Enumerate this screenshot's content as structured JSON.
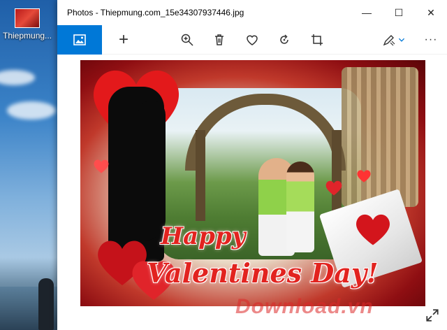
{
  "desktop": {
    "icon_label": "Thiepmung..."
  },
  "window": {
    "title": "Photos - Thiepmung.com_15e34307937446.jpg",
    "controls": {
      "minimize": "—",
      "maximize": "☐",
      "close": "✕"
    }
  },
  "toolbar": {
    "items": [
      {
        "name": "see-all-photos",
        "icon": "image-icon"
      },
      {
        "name": "add",
        "icon": "plus-icon",
        "glyph": "+"
      },
      {
        "name": "zoom",
        "icon": "zoom-in-icon"
      },
      {
        "name": "delete",
        "icon": "trash-icon"
      },
      {
        "name": "favorite",
        "icon": "heart-icon"
      },
      {
        "name": "rotate",
        "icon": "rotate-icon"
      },
      {
        "name": "crop",
        "icon": "crop-icon"
      },
      {
        "name": "edit",
        "icon": "edit-create-icon"
      },
      {
        "name": "more",
        "icon": "more-icon",
        "glyph": "···"
      }
    ],
    "accent": "#0078d7"
  },
  "image": {
    "greeting_line1": "Happy",
    "greeting_line2": "Valentines Day!",
    "watermark": "Download.vn"
  }
}
